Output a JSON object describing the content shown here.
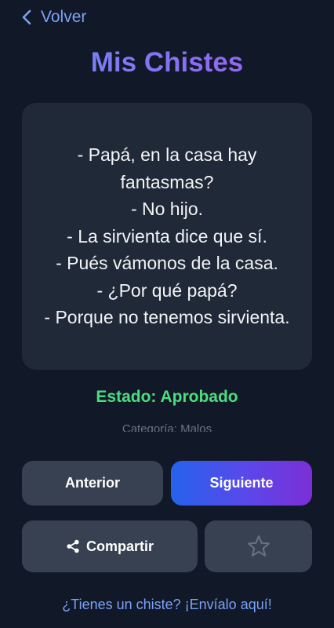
{
  "nav": {
    "back_label": "Volver"
  },
  "header": {
    "title": "Mis Chistes"
  },
  "joke": {
    "lines": [
      "- Papá, en la casa hay fantasmas?",
      "- No hijo.",
      "- La sirvienta dice que sí.",
      "- Pués vámonos de la casa.",
      "- ¿Por qué papá?",
      "- Porque no tenemos sirvienta."
    ]
  },
  "status": {
    "text": "Estado: Aprobado",
    "color": "#4ade80"
  },
  "category": {
    "text": "Categoría: Malos"
  },
  "buttons": {
    "previous": "Anterior",
    "next": "Siguiente",
    "share": "Compartir",
    "favorite_icon": "star-outline-icon"
  },
  "footer": {
    "submit_link": "¿Tienes un chiste? ¡Envíalo aquí!"
  },
  "colors": {
    "background": "#111827",
    "card": "#1f2937",
    "button": "#374151",
    "accent": "#7aa2f7"
  }
}
